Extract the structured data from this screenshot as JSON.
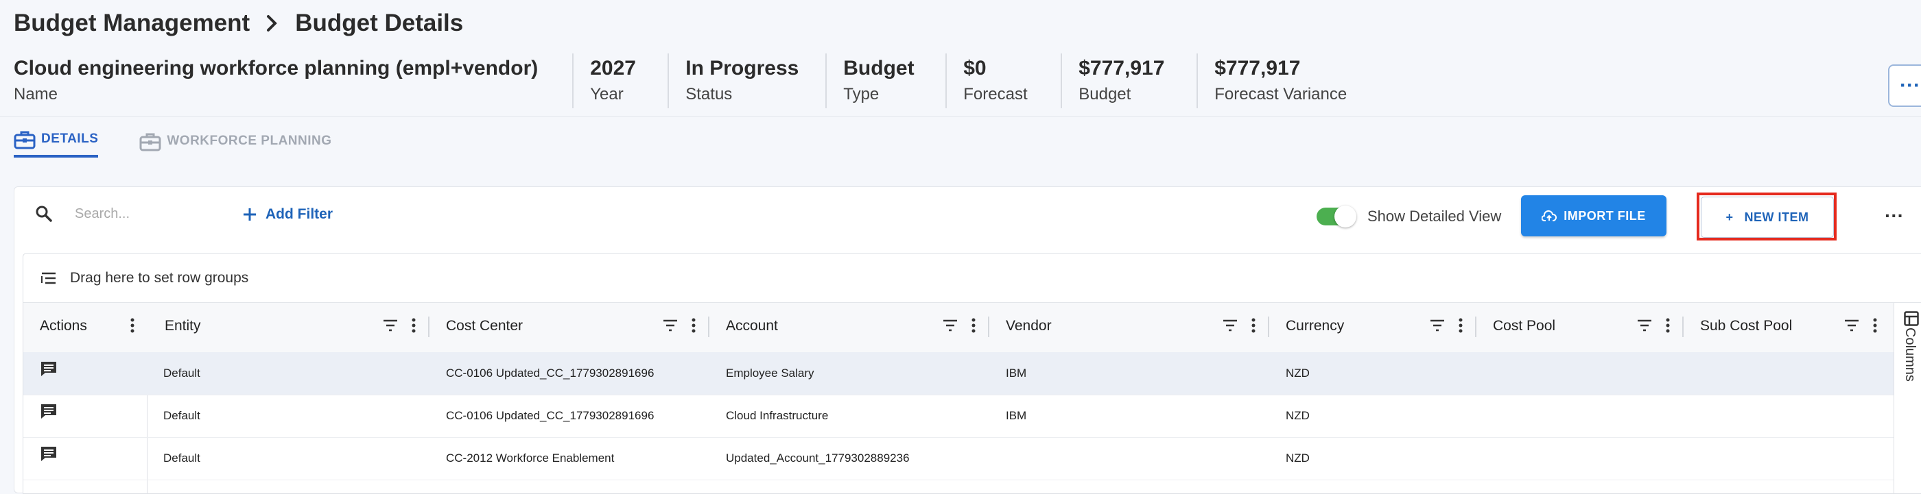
{
  "breadcrumb": {
    "parent": "Budget Management",
    "current": "Budget Details"
  },
  "summary": [
    {
      "value": "Cloud engineering workforce planning (empl+vendor)",
      "label": "Name"
    },
    {
      "value": "2027",
      "label": "Year"
    },
    {
      "value": "In Progress",
      "label": "Status"
    },
    {
      "value": "Budget",
      "label": "Type"
    },
    {
      "value": "$0",
      "label": "Forecast"
    },
    {
      "value": "$777,917",
      "label": "Budget"
    },
    {
      "value": "$777,917",
      "label": "Forecast Variance"
    }
  ],
  "tabs": [
    {
      "label": "DETAILS",
      "active": true,
      "icon": "briefcase-icon"
    },
    {
      "label": "WORKFORCE PLANNING",
      "active": false,
      "icon": "briefcase-icon"
    }
  ],
  "toolbar": {
    "search_placeholder": "Search...",
    "add_filter": "Add Filter",
    "toggle_label": "Show Detailed View",
    "toggle_on": true,
    "import_label": "IMPORT FILE",
    "new_item_label": "NEW ITEM",
    "new_item_prefix": "+"
  },
  "grid": {
    "group_bar_text": "Drag here to set row groups",
    "columns": [
      "Actions",
      "Entity",
      "Cost Center",
      "Account",
      "Vendor",
      "Currency",
      "Cost Pool",
      "Sub Cost Pool"
    ],
    "side_panel_label": "Columns",
    "rows": [
      {
        "entity": "Default",
        "cost_center": "CC-0106 Updated_CC_1779302891696",
        "account": "Employee Salary",
        "vendor": "IBM",
        "currency": "NZD",
        "cost_pool": "",
        "sub_cost_pool": ""
      },
      {
        "entity": "Default",
        "cost_center": "CC-0106 Updated_CC_1779302891696",
        "account": "Cloud Infrastructure",
        "vendor": "IBM",
        "currency": "NZD",
        "cost_pool": "",
        "sub_cost_pool": ""
      },
      {
        "entity": "Default",
        "cost_center": "CC-2012 Workforce Enablement",
        "account": "Updated_Account_1779302889236",
        "vendor": "",
        "currency": "NZD",
        "cost_pool": "",
        "sub_cost_pool": ""
      }
    ]
  },
  "colors": {
    "accent": "#2284e6",
    "link": "#1e63b8",
    "toggle_on": "#4caf50",
    "highlight": "#e52a1e"
  }
}
